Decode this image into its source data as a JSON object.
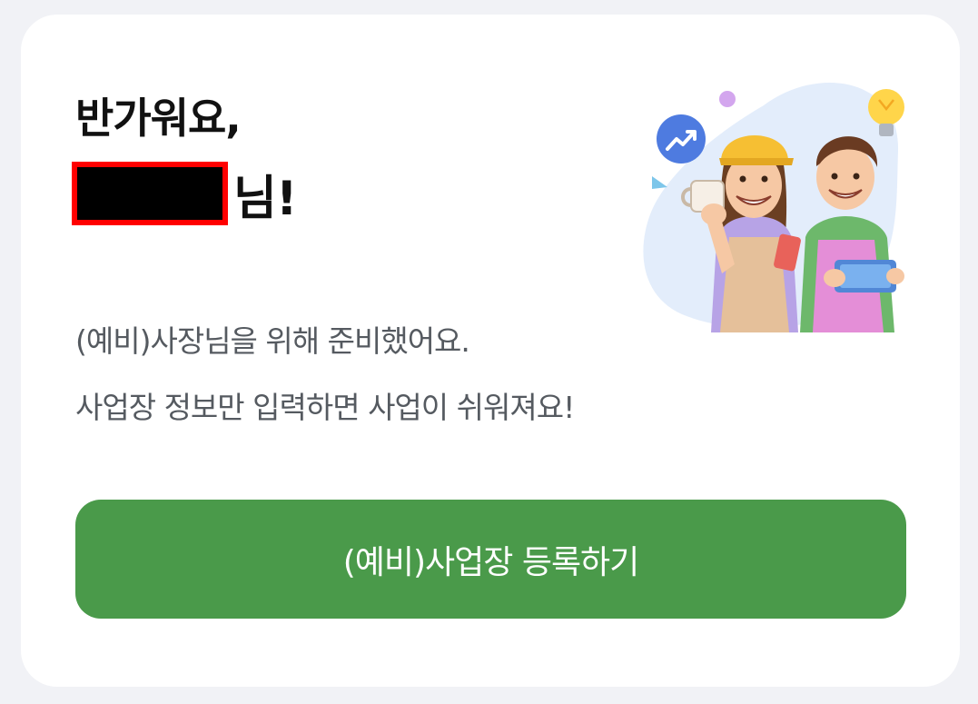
{
  "greeting": {
    "line1": "반가워요,",
    "name_suffix": "님!"
  },
  "description": {
    "line1": "(예비)사장님을 위해 준비했어요.",
    "line2": "사업장 정보만 입력하면 사업이 쉬워져요!"
  },
  "register_button": {
    "label": "(예비)사업장 등록하기"
  },
  "colors": {
    "button": "#4a9a4a",
    "redaction_border": "#ff0000",
    "background": "#f1f2f6"
  },
  "icons": [
    "trend-up-icon",
    "lightbulb-icon"
  ]
}
